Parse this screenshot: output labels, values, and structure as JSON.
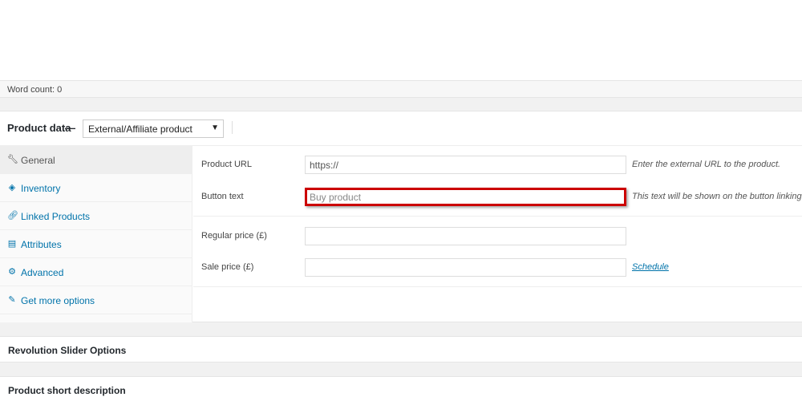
{
  "editor": {
    "word_count": "Word count: 0"
  },
  "product_data": {
    "title": "Product data —",
    "type_selected": "External/Affiliate product",
    "tabs": [
      {
        "label": "General",
        "icon": "wrench-icon",
        "glyph": "🔧"
      },
      {
        "label": "Inventory",
        "icon": "tag-icon",
        "glyph": "◈"
      },
      {
        "label": "Linked Products",
        "icon": "link-icon",
        "glyph": "🔗"
      },
      {
        "label": "Attributes",
        "icon": "list-icon",
        "glyph": "▤"
      },
      {
        "label": "Advanced",
        "icon": "gear-icon",
        "glyph": "⚙"
      },
      {
        "label": "Get more options",
        "icon": "plugin-icon",
        "glyph": "✎"
      }
    ],
    "fields": {
      "product_url": {
        "label": "Product URL",
        "value": "https://",
        "description": "Enter the external URL to the product."
      },
      "button_text": {
        "label": "Button text",
        "value": "Buy product",
        "description": "This text will be shown on the button linking"
      },
      "regular_price": {
        "label": "Regular price (£)",
        "value": ""
      },
      "sale_price": {
        "label": "Sale price (£)",
        "value": "",
        "schedule_link": "Schedule"
      }
    }
  },
  "boxes": {
    "revolution_slider": "Revolution Slider Options",
    "short_description": "Product short description"
  },
  "colors": {
    "highlight": "#cc0000",
    "link": "#0073aa"
  }
}
